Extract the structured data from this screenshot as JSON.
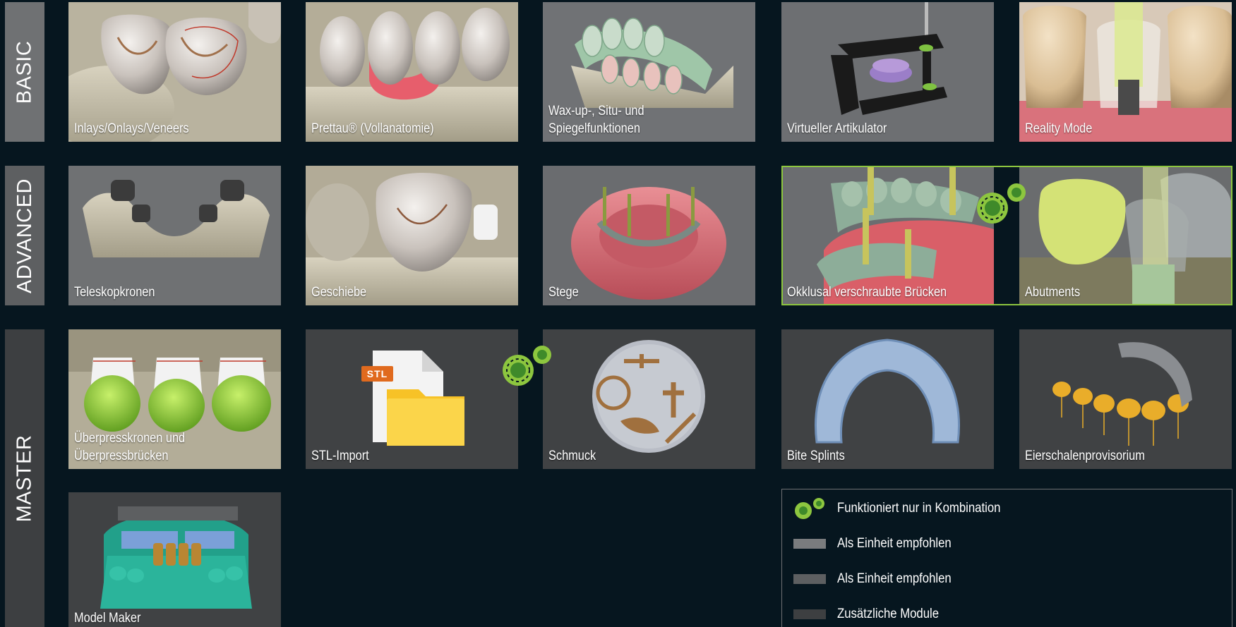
{
  "tiers": {
    "basic": "BASIC",
    "advanced": "ADVANCED",
    "master": "MASTER"
  },
  "modules": {
    "inlays": "Inlays/Onlays/Veneers",
    "prettau": "Prettau® (Vollanatomie)",
    "waxup_line1": "Wax-up-, Situ- und",
    "waxup_line2": "Spiegelfunktionen",
    "artikulator": "Virtueller Artikulator",
    "reality": "Reality Mode",
    "teleskop": "Teleskopkronen",
    "geschiebe": "Geschiebe",
    "stege": "Stege",
    "okklusal": "Okklusal verschraubte Brücken",
    "abutments": "Abutments",
    "ueberpress_line1": "Überpresskronen und",
    "ueberpress_line2": "Überpressbrücken",
    "stl": "STL-Import",
    "stl_badge": "STL",
    "schmuck": "Schmuck",
    "bite": "Bite Splints",
    "eierschalen": "Eierschalenprovisorium",
    "model_maker": "Model Maker"
  },
  "legend": {
    "combo": "Funktioniert nur in Kombination",
    "unit1": "Als Einheit empfohlen",
    "unit2": "Als Einheit empfohlen",
    "additional": "Zusätzliche Module"
  },
  "colors": {
    "background": "#06161f",
    "accent_green": "#8dc63f",
    "basic_gray": "#6f7173",
    "advanced_gray": "#5d5f61",
    "master_gray": "#3d3f41"
  }
}
